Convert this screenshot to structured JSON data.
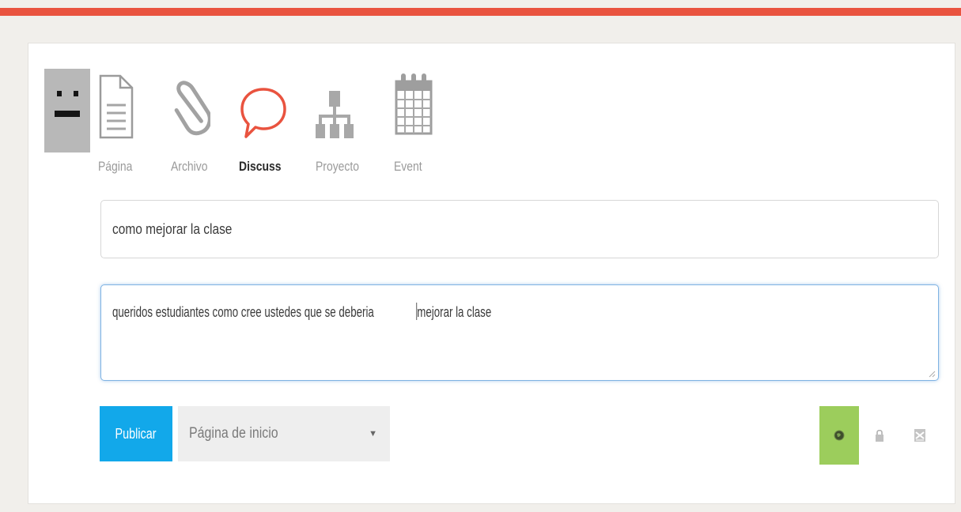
{
  "theme": {
    "accent": "#e9533f",
    "publish": "#12a8ea",
    "public_active": "#9ccd5c"
  },
  "post_types": [
    {
      "label": "Página",
      "icon": "page-icon",
      "active": false
    },
    {
      "label": "Archivo",
      "icon": "paperclip-icon",
      "active": false
    },
    {
      "label": "Discuss",
      "icon": "speech-bubble-icon",
      "active": true
    },
    {
      "label": "Proyecto",
      "icon": "org-chart-icon",
      "active": false
    },
    {
      "label": "Event",
      "icon": "calendar-icon",
      "active": false
    }
  ],
  "form": {
    "title_value": "como mejorar la clase",
    "body_before_caret": "queridos estudiantes como cree ustedes que se deberia",
    "body_after_caret": "mejorar la clase"
  },
  "actions": {
    "publish_label": "Publicar",
    "destination_selected": "Página de inicio"
  },
  "privacy": {
    "options": [
      {
        "icon": "globe-icon",
        "active": true
      },
      {
        "icon": "lock-icon",
        "active": false
      },
      {
        "icon": "draft-icon",
        "active": false
      }
    ]
  }
}
